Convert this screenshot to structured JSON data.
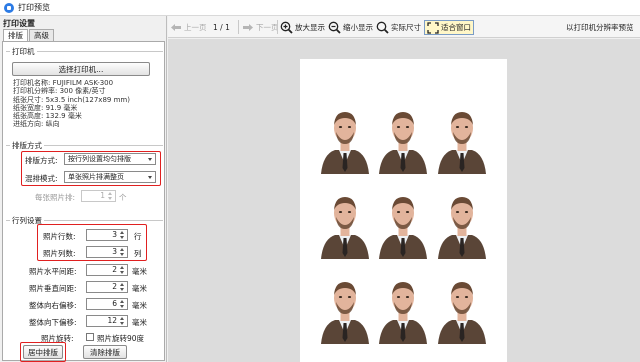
{
  "window": {
    "title": "打印预览"
  },
  "panel": {
    "header": "打印设置",
    "tabs": [
      "排版",
      "高级"
    ],
    "printer_group": {
      "title": "打印机",
      "select_button": "选择打印机...",
      "info": [
        "打印机名称: FUJIFILM ASK-300",
        "打印机分辨率: 300 像素/英寸",
        "纸张尺寸: 5x3.5 inch(127x89 mm)",
        "纸张宽度: 91.9 毫米",
        "纸张高度: 132.9 毫米",
        "进纸方向: 纵向"
      ]
    },
    "layout_group": {
      "title": "排版方式",
      "layout_label": "排版方式:",
      "layout_value": "按行列设置均匀排版",
      "mix_label": "混排模式:",
      "mix_value": "单张照片排满整页",
      "per_photo_label": "每张照片排:",
      "per_photo_value": "1",
      "per_photo_unit": "个"
    },
    "grid_group": {
      "title": "行列设置",
      "rows_label": "照片行数:",
      "rows_value": "3",
      "rows_unit": "行",
      "cols_label": "照片列数:",
      "cols_value": "3",
      "cols_unit": "列",
      "hgap_label": "照片水平间距:",
      "hgap_value": "2",
      "vgap_label": "照片垂直间距:",
      "vgap_value": "2",
      "right_label": "整体向右偏移:",
      "right_value": "6",
      "down_label": "整体向下偏移:",
      "down_value": "12",
      "unit_mm": "毫米",
      "rotate_label": "照片旋转:",
      "rotate_check_label": "照片旋转90度",
      "rotate_checked": false
    },
    "center_button": "居中排版",
    "clear_button": "清除排版"
  },
  "toolbar": {
    "prev": "上一页",
    "page_info": "1 / 1",
    "next": "下一页",
    "zoom_in": "放大显示",
    "zoom_out": "缩小显示",
    "actual": "实际尺寸",
    "fit": "适合窗口",
    "resolution_note": "以打印机分辨率预览"
  },
  "preview": {
    "rows": 3,
    "cols": 3,
    "photo_colors": {
      "suit": "#5a4537",
      "shirt": "#eef1f4",
      "tie": "#2a2422",
      "skin": "#e2b49c",
      "hair": "#6a4a35"
    }
  },
  "colors": {
    "highlight_border": "#e02020",
    "accent": "#2c7be5"
  }
}
